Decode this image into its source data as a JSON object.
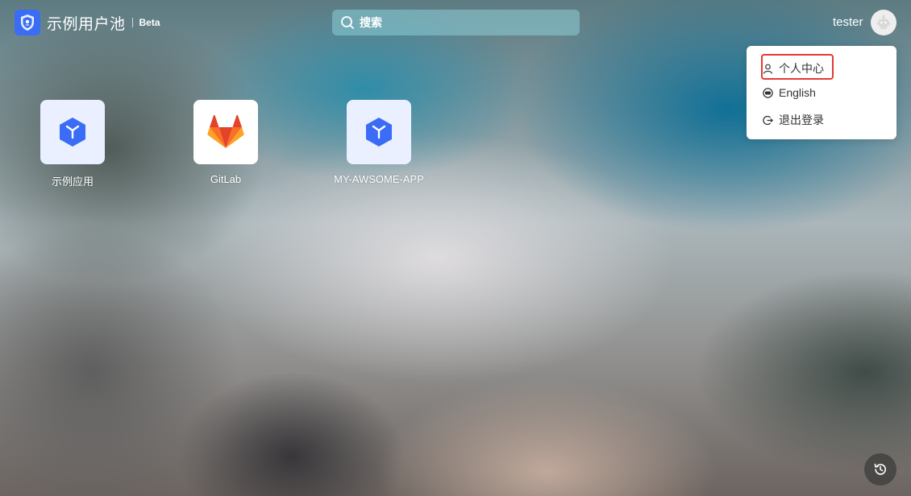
{
  "header": {
    "app_name": "示例用户池",
    "badge": "Beta",
    "logo_icon": "shield-icon",
    "brand_color": "#3b6cf5"
  },
  "search": {
    "placeholder": "搜索",
    "value": "",
    "icon": "search-icon"
  },
  "user": {
    "name": "tester",
    "avatar_icon": "robot-avatar-icon"
  },
  "user_menu": {
    "items": [
      {
        "label": "个人中心",
        "icon": "user-icon",
        "highlighted": true
      },
      {
        "label": "English",
        "icon": "language-icon",
        "highlighted": false
      },
      {
        "label": "退出登录",
        "icon": "logout-icon",
        "highlighted": false
      }
    ],
    "highlight_color": "#e53935"
  },
  "apps": [
    {
      "label": "示例应用",
      "icon": "cube-app-icon",
      "tile_bg": "#eaf0ff"
    },
    {
      "label": "GitLab",
      "icon": "gitlab-icon",
      "tile_bg": "#ffffff"
    },
    {
      "label": "MY-AWSOME-APP",
      "icon": "cube-app-icon",
      "tile_bg": "#eaf0ff"
    }
  ],
  "footer": {
    "history_icon": "history-icon"
  }
}
